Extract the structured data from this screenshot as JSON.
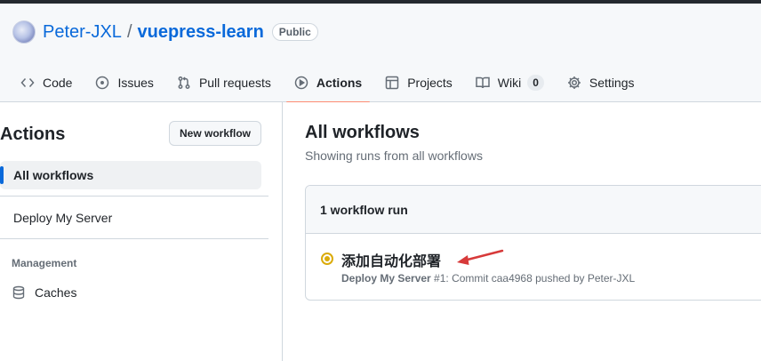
{
  "repo": {
    "owner": "Peter-JXL",
    "separator": "/",
    "name": "vuepress-learn",
    "visibility": "Public"
  },
  "tabs": [
    {
      "label": "Code",
      "icon": "code-icon"
    },
    {
      "label": "Issues",
      "icon": "issue-icon"
    },
    {
      "label": "Pull requests",
      "icon": "pull-request-icon"
    },
    {
      "label": "Actions",
      "icon": "play-icon",
      "selected": true
    },
    {
      "label": "Projects",
      "icon": "table-icon"
    },
    {
      "label": "Wiki",
      "icon": "book-icon",
      "counter": "0"
    },
    {
      "label": "Settings",
      "icon": "gear-icon"
    }
  ],
  "sidebar": {
    "title": "Actions",
    "new_workflow_label": "New workflow",
    "items": [
      {
        "label": "All workflows",
        "active": true
      },
      {
        "label": "Deploy My Server"
      }
    ],
    "management_label": "Management",
    "caches_label": "Caches"
  },
  "content": {
    "title": "All workflows",
    "subtitle": "Showing runs from all workflows",
    "runs_count_label": "1 workflow run",
    "run": {
      "title": "添加自动化部署",
      "workflow_name": "Deploy My Server",
      "details": " #1: Commit caa4968 pushed by Peter-JXL",
      "status": "in-progress"
    }
  },
  "colors": {
    "accent": "#0969da",
    "tab_underline": "#fd8c73",
    "status_in_progress": "#dbab0a",
    "annotation_arrow": "#d73a3a"
  }
}
